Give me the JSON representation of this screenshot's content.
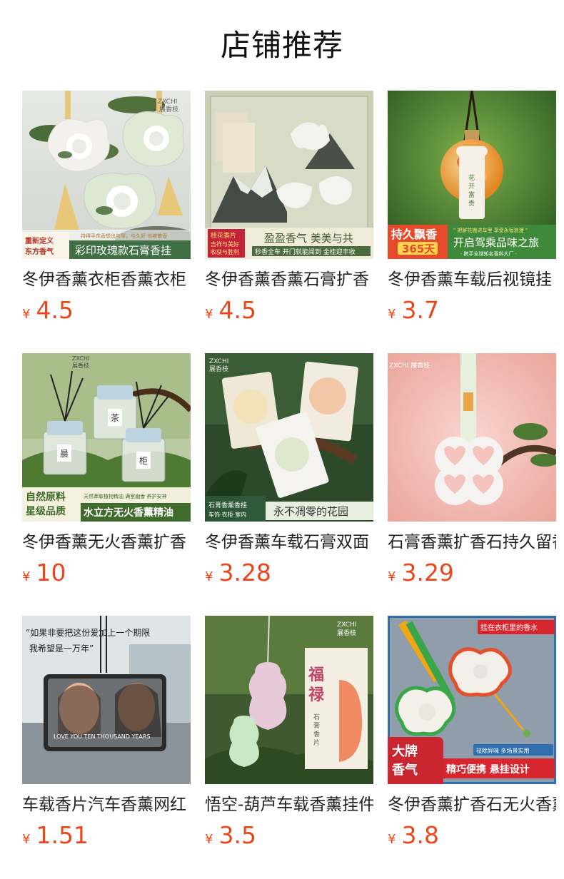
{
  "header": {
    "title": "店铺推荐"
  },
  "currency": "¥",
  "products": [
    {
      "name": "冬伊香薰衣柜香薰衣柜",
      "price": "4.5",
      "image": {
        "brand": "ZXCHI 展香枝",
        "tagline": "持得手花香想出与琴，与久好 也被散香",
        "badge": "重新定义 东方香气",
        "caption": "彩印玫瑰款石膏香挂"
      }
    },
    {
      "name": "冬伊香薰香薰石膏扩香",
      "price": "4.5",
      "image": {
        "badge": "桂花香片 吉祥与美好 收获与胜利",
        "caption": "盈盈香气 美美与共",
        "subcaption": "秒香全车 开门就能闻到 金桂迎丰收"
      }
    },
    {
      "name": "冬伊香薰车载后视镜挂",
      "price": "3.7",
      "image": {
        "badge": "持久飘香",
        "badge_days": "365天",
        "top_note": "\" 把鲜花搬进车里 享受永恒浪漫 \"",
        "caption": "开启驾乘品味之旅",
        "subcaption": "· 携手全球知名香料大厂 ·",
        "tag_text": "花开富贵"
      }
    },
    {
      "name": "冬伊香薰无火香薰扩香",
      "price": "10",
      "image": {
        "brand": "ZXCHI 展香枝",
        "badge": "自然原料 星级品质",
        "small_text": "天然萃取植物精油 满室幽香 养护安神",
        "caption": "水立方无火香薰精油",
        "bottle_labels": [
          "晨",
          "茶",
          "柜"
        ]
      }
    },
    {
      "name": "冬伊香薰车载石膏双面",
      "price": "3.28",
      "image": {
        "brand": "ZXCHI 展香枝",
        "badge": "石膏香薰香挂",
        "badge_sub": "车饰·衣柜·室内",
        "caption": "永不凋零的花园"
      }
    },
    {
      "name": "石膏香薰扩香石持久留香",
      "price": "3.29",
      "image": {
        "brand": "ZXCHI 展香枝",
        "tag_text": "展香枝"
      }
    },
    {
      "name": "车载香片汽车香薰网红",
      "price": "1.51",
      "image": {
        "quote_line1": "“如果非要把这份爱加上一个期限",
        "quote_line2": "我希望是一万年”",
        "card_text": "LOVE YOU TEN THOUSAND YEARS"
      }
    },
    {
      "name": "悟空-葫芦车载香薰挂件",
      "price": "3.5",
      "image": {
        "brand": "ZXCHI 展香枝",
        "box_title": "福禄",
        "box_sub": "石膏香片"
      }
    },
    {
      "name": "冬伊香薰扩香石无火香薰",
      "price": "3.8",
      "image": {
        "top_badge": "挂在衣柜里的香水",
        "small_badge": "祛除异味 多场景实用",
        "badge": "大牌 香气",
        "caption": "精巧便携 悬挂设计"
      }
    }
  ]
}
